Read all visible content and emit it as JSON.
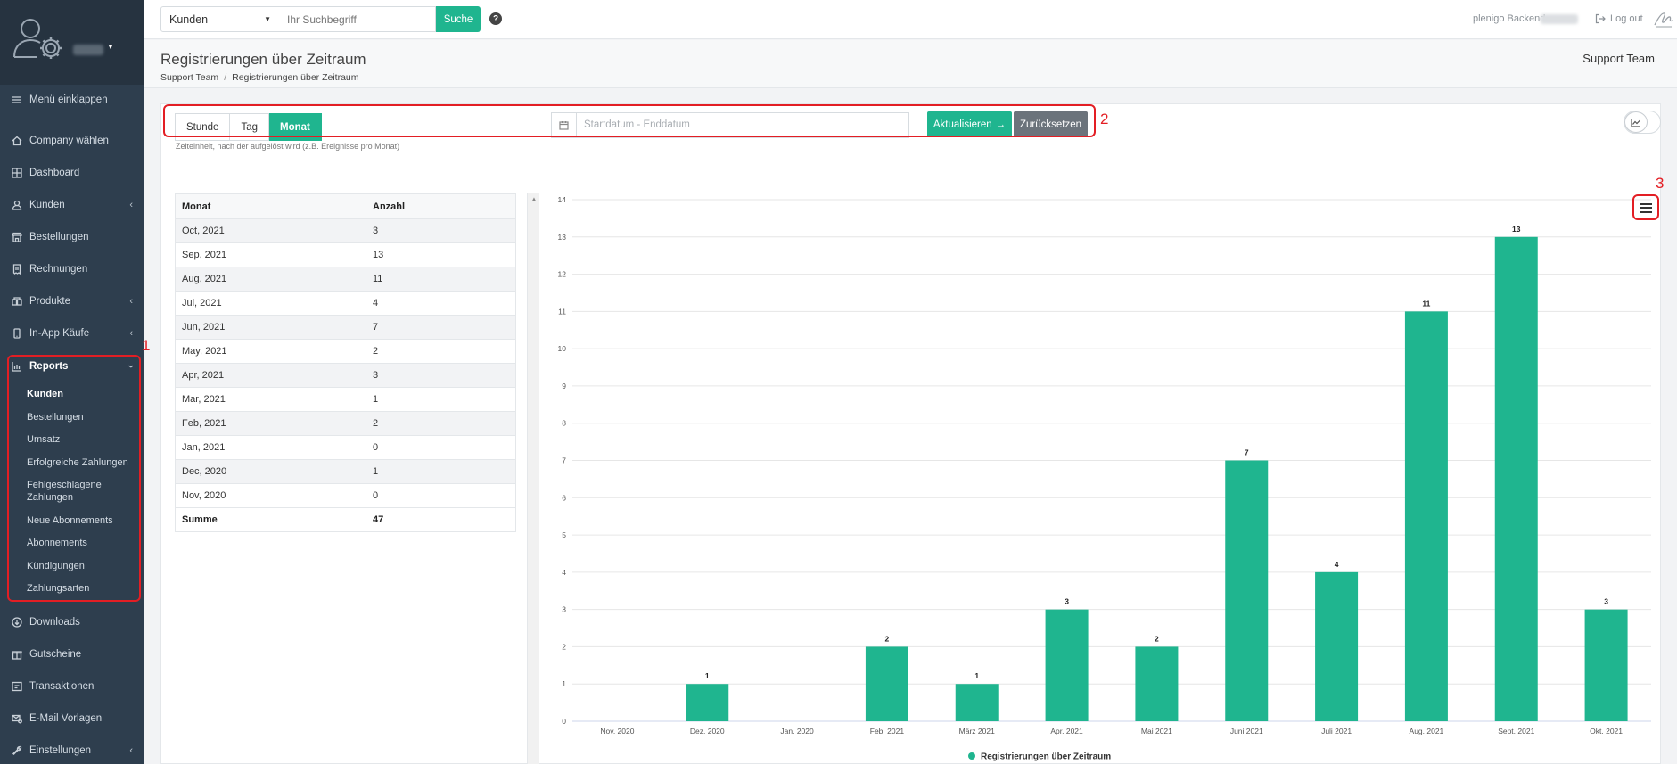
{
  "sidebar": {
    "collapse_label": "Menü einklappen",
    "items": [
      {
        "label": "Company wählen",
        "icon": "home-icon"
      },
      {
        "label": "Dashboard",
        "icon": "grid-icon"
      },
      {
        "label": "Kunden",
        "icon": "user-icon"
      },
      {
        "label": "Bestellungen",
        "icon": "shop-icon"
      },
      {
        "label": "Rechnungen",
        "icon": "receipt-icon"
      },
      {
        "label": "Produkte",
        "icon": "box-icon"
      },
      {
        "label": "In-App Käufe",
        "icon": "phone-icon"
      },
      {
        "label": "Reports",
        "icon": "chart-icon"
      },
      {
        "label": "Downloads",
        "icon": "download-icon"
      },
      {
        "label": "Gutscheine",
        "icon": "gift-icon"
      },
      {
        "label": "Transaktionen",
        "icon": "transaction-icon"
      },
      {
        "label": "E-Mail Vorlagen",
        "icon": "mail-settings-icon"
      },
      {
        "label": "Einstellungen",
        "icon": "wrench-icon"
      }
    ],
    "reports_sub": [
      "Kunden",
      "Bestellungen",
      "Umsatz",
      "Erfolgreiche Zahlungen",
      "Fehlgeschlagene Zahlungen",
      "Neue Abonnements",
      "Abonnements",
      "Kündigungen",
      "Zahlungsarten"
    ]
  },
  "annotations": {
    "one": "1",
    "two": "2",
    "three": "3"
  },
  "topbar": {
    "select_value": "Kunden",
    "search_placeholder": "Ihr Suchbegriff",
    "search_button": "Suche",
    "help": "?",
    "backend_label": "plenigo Backend",
    "logout": "Log out"
  },
  "page": {
    "title": "Registrierungen über Zeitraum",
    "breadcrumb": [
      "Support Team",
      "Registrierungen über Zeitraum"
    ],
    "team": "Support Team"
  },
  "filters": {
    "units": [
      "Stunde",
      "Tag",
      "Monat"
    ],
    "active_unit": "Monat",
    "date_placeholder": "Startdatum - Enddatum",
    "update_button": "Aktualisieren",
    "reset_button": "Zurücksetzen",
    "hint": "Zeiteinheit, nach der aufgelöst wird (z.B. Ereignisse pro Monat)"
  },
  "table": {
    "headers": [
      "Monat",
      "Anzahl"
    ],
    "rows": [
      [
        "Oct, 2021",
        "3"
      ],
      [
        "Sep, 2021",
        "13"
      ],
      [
        "Aug, 2021",
        "11"
      ],
      [
        "Jul, 2021",
        "4"
      ],
      [
        "Jun, 2021",
        "7"
      ],
      [
        "May, 2021",
        "2"
      ],
      [
        "Apr, 2021",
        "3"
      ],
      [
        "Mar, 2021",
        "1"
      ],
      [
        "Feb, 2021",
        "2"
      ],
      [
        "Jan, 2021",
        "0"
      ],
      [
        "Dec, 2020",
        "1"
      ],
      [
        "Nov, 2020",
        "0"
      ]
    ],
    "footer": [
      "Summe",
      "47"
    ]
  },
  "chart_data": {
    "type": "bar",
    "categories": [
      "Nov. 2020",
      "Dez. 2020",
      "Jan. 2020",
      "Feb. 2021",
      "März 2021",
      "Apr. 2021",
      "Mai 2021",
      "Juni 2021",
      "Juli 2021",
      "Aug. 2021",
      "Sept. 2021",
      "Okt. 2021"
    ],
    "series": [
      {
        "name": "Registrierungen über Zeitraum",
        "values": [
          0,
          1,
          0,
          2,
          1,
          3,
          2,
          7,
          4,
          11,
          13,
          3
        ],
        "color": "#1fb58f"
      }
    ],
    "ylim": [
      0,
      14
    ],
    "yticks": [
      0,
      1,
      2,
      3,
      4,
      5,
      6,
      7,
      8,
      9,
      10,
      11,
      12,
      13,
      14
    ],
    "grid": true,
    "legend": "bottom",
    "data_labels": true
  },
  "colors": {
    "accent": "#1fb58f",
    "sidebar": "#2e3e4e",
    "annotation": "#e31e24"
  }
}
